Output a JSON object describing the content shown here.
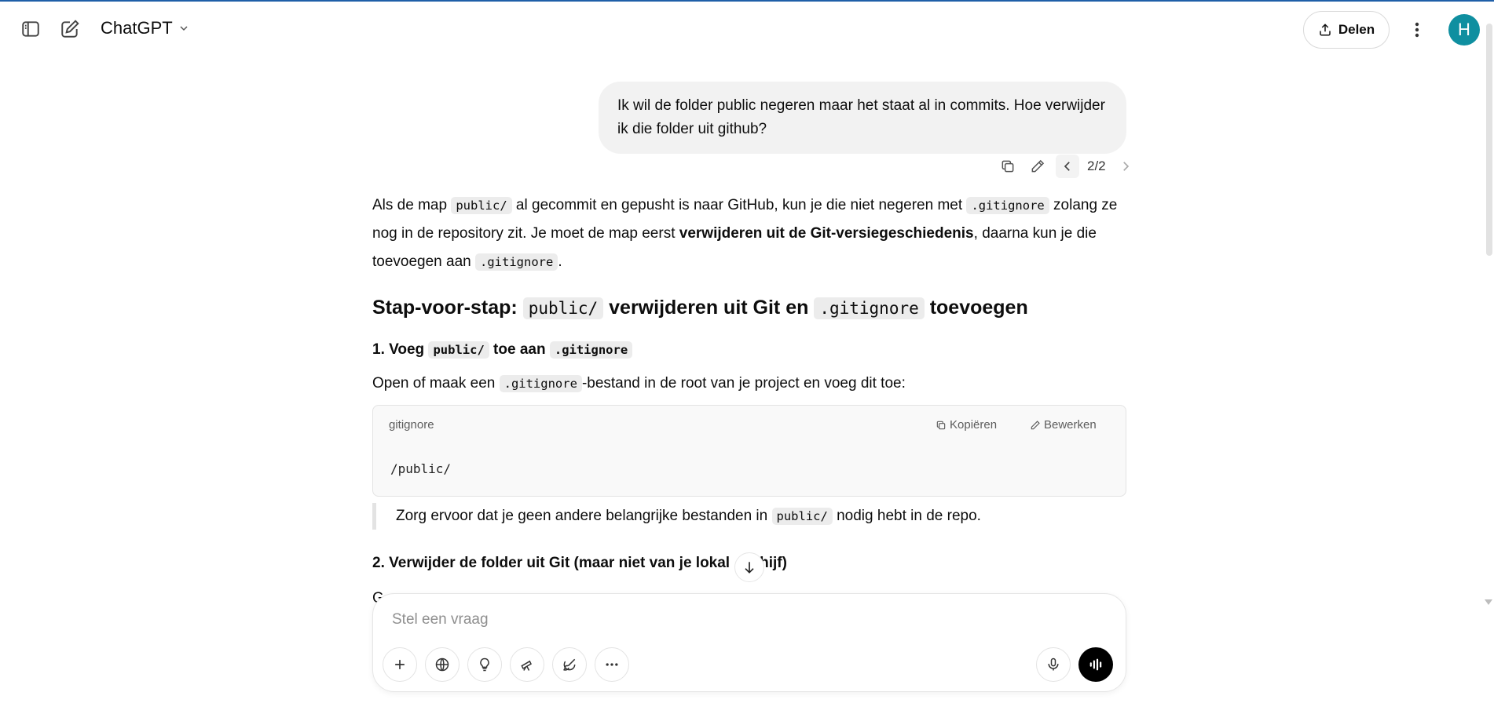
{
  "header": {
    "model_name": "ChatGPT",
    "share_label": "Delen",
    "avatar_letter": "H",
    "icons": [
      "sidebar-toggle-icon",
      "new-chat-icon",
      "chevron-down-icon",
      "upload-icon",
      "more-vertical-icon"
    ]
  },
  "user_message": {
    "text": "Ik wil de folder public negeren maar het staat al in commits. Hoe verwijder ik die folder uit github?",
    "branch_count": "2/2"
  },
  "assistant": {
    "intro": {
      "t1": "Als de map ",
      "c1": "public/",
      "t2": " al gecommit en gepusht is naar GitHub, kun je die niet negeren met ",
      "c2": ".gitignore",
      "t3": " zolang ze nog in de repository zit. Je moet de map eerst ",
      "b1": "verwijderen uit de Git-versiegeschiedenis",
      "t4": ", daarna kun je die toevoegen aan ",
      "c3": ".gitignore",
      "t5": "."
    },
    "heading": {
      "t1": "Stap-voor-stap: ",
      "c1": "public/",
      "t2": " verwijderen uit Git en ",
      "c2": ".gitignore",
      "t3": " toevoegen"
    },
    "step1": {
      "t1": "1. Voeg ",
      "c1": "public/",
      "t2": " toe aan ",
      "c2": ".gitignore"
    },
    "step1_text": {
      "t1": "Open of maak een ",
      "c1": ".gitignore",
      "t2": "-bestand in de root van je project en voeg dit toe:"
    },
    "code_block": {
      "language": "gitignore",
      "copy_label": "Kopiëren",
      "edit_label": "Bewerken",
      "code": "/public/"
    },
    "note": {
      "t1": "Zorg ervoor dat je geen andere belangrijke bestanden in ",
      "c1": "public/",
      "t2": " nodig hebt in de repo."
    },
    "step2": {
      "t1": "2. Verwijder de folder uit Git (maar niet van je lokal",
      "t2": "hijf)"
    },
    "cut_text": "G"
  },
  "composer": {
    "placeholder": "Stel een vraag",
    "tools": [
      "plus-icon",
      "globe-icon",
      "lightbulb-icon",
      "telescope-icon",
      "paintbrush-icon",
      "more-horizontal-icon"
    ]
  }
}
